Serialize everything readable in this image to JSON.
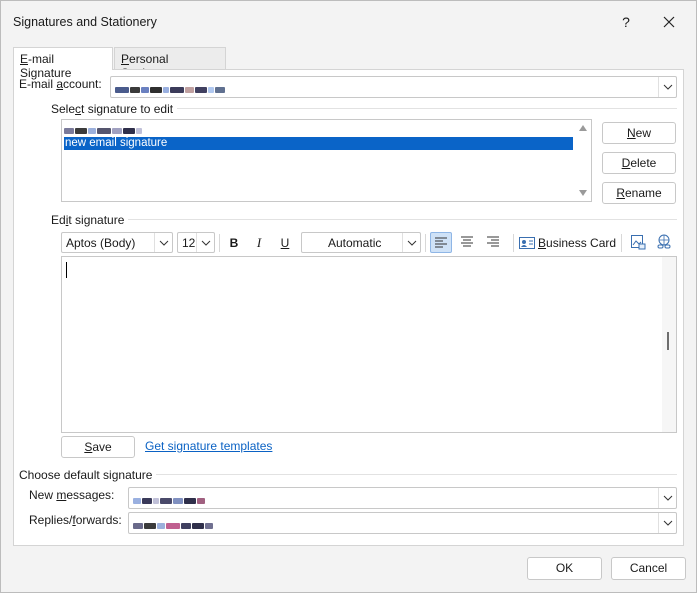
{
  "window": {
    "title": "Signatures and Stationery",
    "help_label": "?"
  },
  "tabs": [
    {
      "label_prefix": "",
      "label_u": "E",
      "label_rest": "-mail Signature"
    },
    {
      "label_prefix": "",
      "label_u": "P",
      "label_rest": "ersonal Stationery"
    }
  ],
  "email_account": {
    "label_prefix": "E-mail ",
    "label_u": "a",
    "label_rest": "ccount:"
  },
  "select_sig": {
    "label_prefix": "Sele",
    "label_u": "c",
    "label_rest": "t signature to edit",
    "items": [
      {
        "label": "",
        "redacted": true
      },
      {
        "label": "new email signature",
        "selected": true
      }
    ]
  },
  "side_buttons": {
    "new": {
      "u": "N",
      "rest": "ew"
    },
    "delete": {
      "u": "D",
      "rest": "elete"
    },
    "rename": {
      "u": "R",
      "rest": "ename"
    }
  },
  "edit_sig": {
    "label_prefix": "Ed",
    "label_u": "i",
    "label_rest": "t signature",
    "font_name": "Aptos (Body)",
    "font_size": "12",
    "bold": "B",
    "italic": "I",
    "underline": "U",
    "color": "Automatic",
    "business_card_prefix": "",
    "business_card_u": "B",
    "business_card_rest": "usiness Card"
  },
  "save": {
    "u": "S",
    "rest": "ave"
  },
  "templates_link": "Get signature templates",
  "default_sig": {
    "heading": "Choose default signature",
    "new_messages": {
      "prefix": "New ",
      "u": "m",
      "rest": "essages:"
    },
    "replies": {
      "prefix": "Replies/",
      "u": "f",
      "rest": "orwards:"
    }
  },
  "footer": {
    "ok": "OK",
    "cancel": "Cancel"
  },
  "colors": {
    "accent": "#0a64c8",
    "link": "#0b62c4"
  }
}
